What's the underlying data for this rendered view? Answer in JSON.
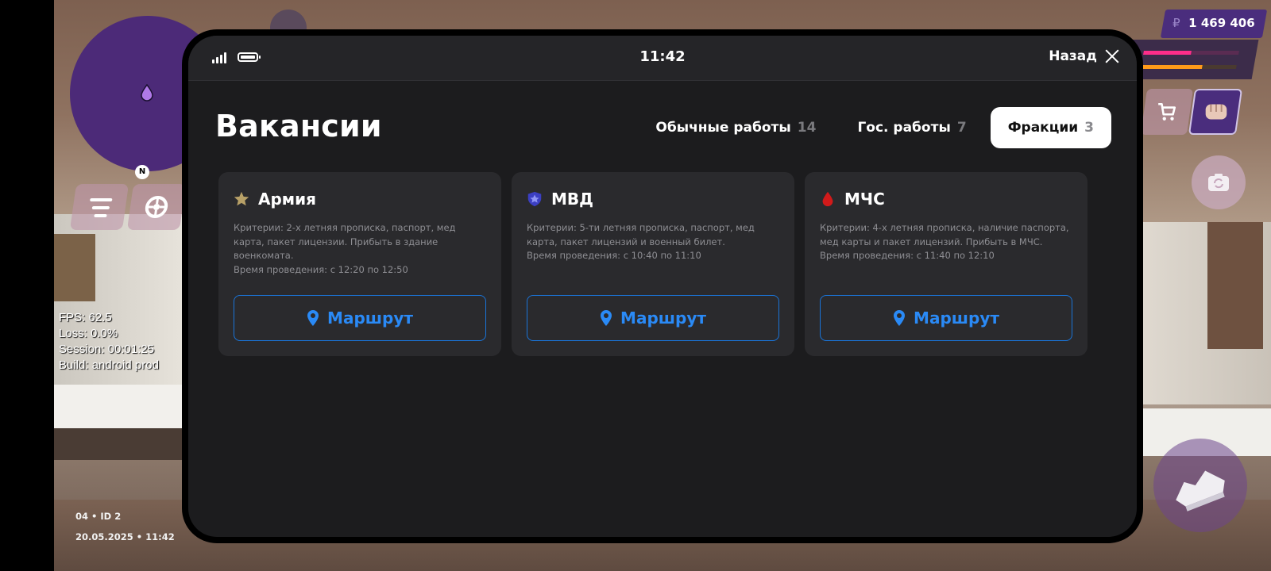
{
  "hud": {
    "money_symbol": "₽",
    "money": "1 469 406",
    "compass": "N",
    "net_info": {
      "fps": "FPS: 62.5",
      "loss": "Loss: 0.0%",
      "session": "Session: 00:01:25",
      "build": "Build: android prod"
    },
    "server_id": "04 • ID 2",
    "datetime": "20.05.2025 • 11:42",
    "health_level": 0.5,
    "armor_level": 0.64
  },
  "phone": {
    "time": "11:42",
    "back_label": "Назад",
    "title": "Вакансии",
    "tabs": [
      {
        "label": "Обычные работы",
        "count": "14",
        "active": false
      },
      {
        "label": "Гос. работы",
        "count": "7",
        "active": false
      },
      {
        "label": "Фракции",
        "count": "3",
        "active": true
      }
    ],
    "cards": [
      {
        "icon": "star-icon",
        "title": "Армия",
        "description": "Критерии: 2-х летняя прописка, паспорт, мед карта, пакет лицензии. Прибыть в здание военкомата.",
        "schedule": "Время проведения: с 12:20 по 12:50",
        "button": "Маршрут"
      },
      {
        "icon": "police-shield-icon",
        "title": "МВД",
        "description": "Критерии: 5-ти летняя прописка, паспорт, мед карта, пакет лицензий и военный билет.",
        "schedule": "Время проведения: с 10:40 по 11:10",
        "button": "Маршрут"
      },
      {
        "icon": "blood-drop-icon",
        "title": "МЧС",
        "description": "Критерии: 4-х летняя прописка, наличие паспорта, мед карты и пакет лицензий. Прибыть в МЧС.",
        "schedule": "Время проведения: с 11:40 по 12:10",
        "button": "Маршрут"
      }
    ]
  },
  "colors": {
    "accent_blue": "#2a8af6",
    "purple": "#4c2a78",
    "panel": "#1c1c1e",
    "card": "#2a2a2d"
  }
}
